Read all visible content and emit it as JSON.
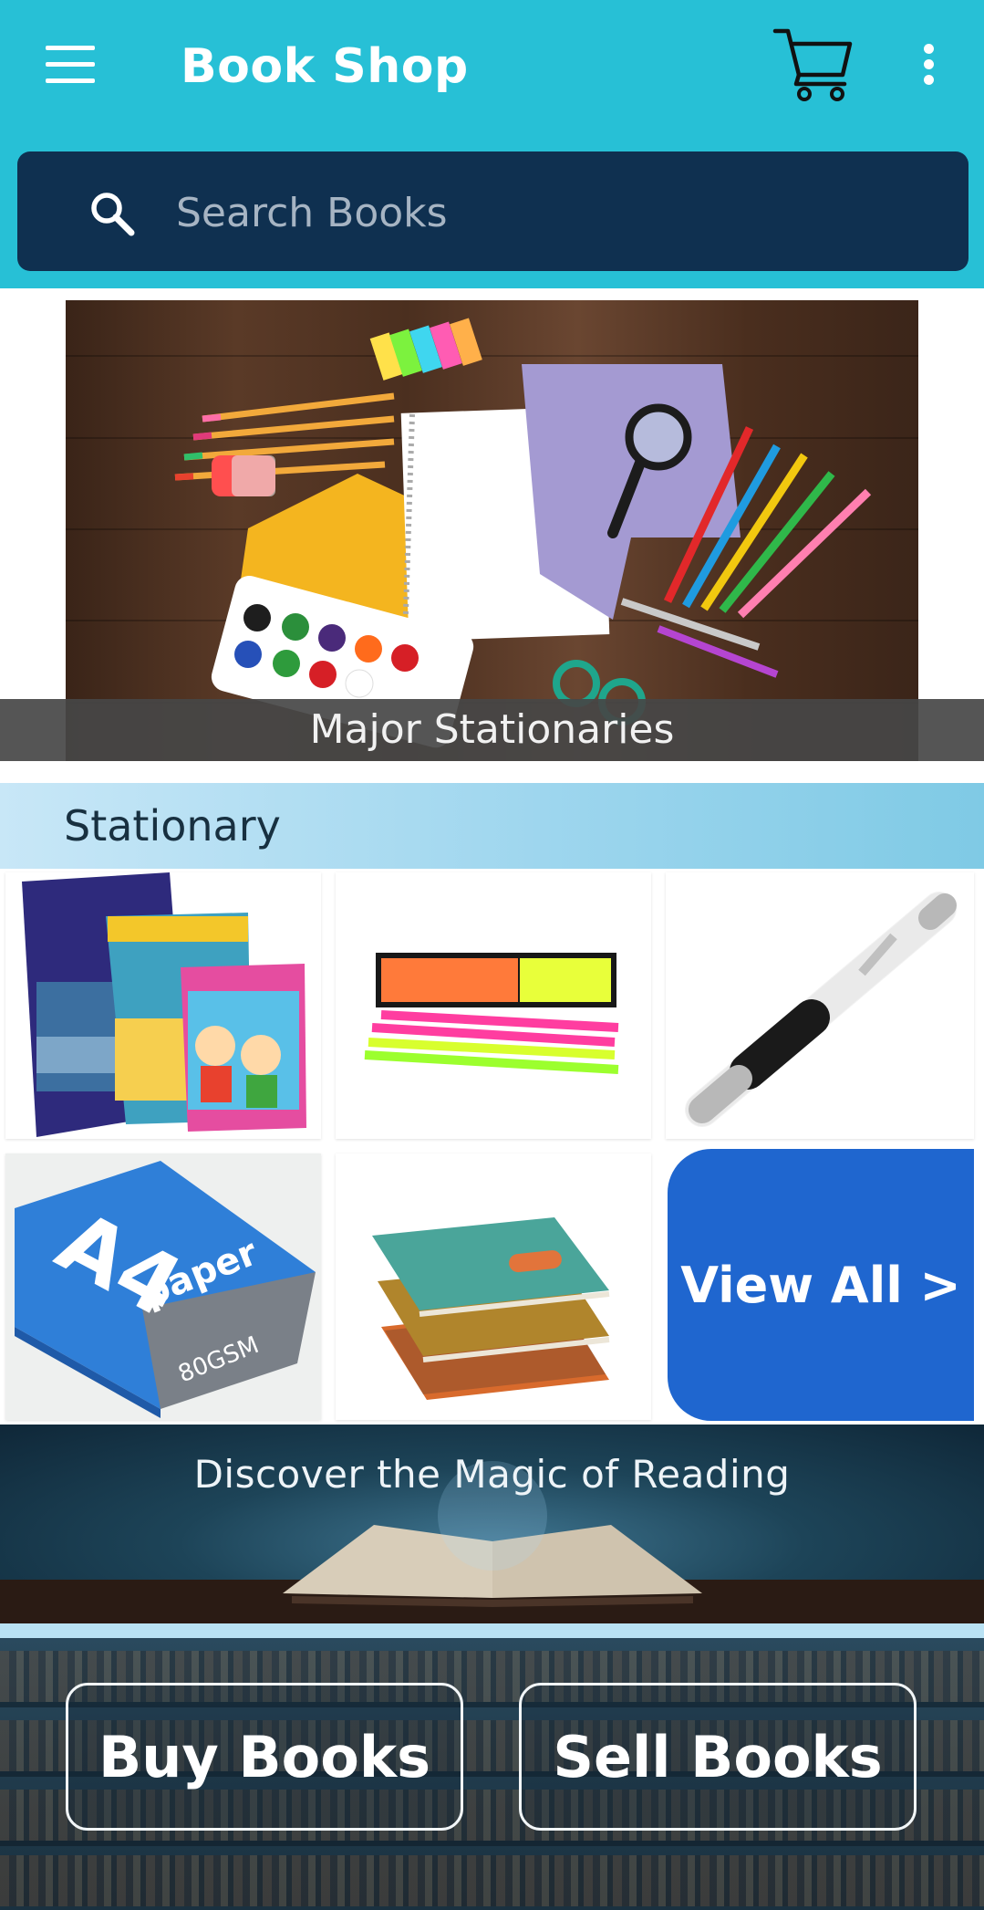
{
  "app_bar": {
    "title": "Book Shop",
    "menu_icon": "hamburger-menu-icon",
    "cart_icon": "shopping-cart-icon",
    "more_icon": "more-vertical-icon",
    "background_color": "#27c0d6"
  },
  "search": {
    "placeholder": "Search Books",
    "value": "",
    "icon": "search-icon",
    "background_color": "#0f3050"
  },
  "hero_banner": {
    "caption": "Major Stationaries"
  },
  "stationary_section": {
    "title": "Stationary",
    "products": [
      {
        "name": "classmate-notebooks",
        "image": "notebooks-image"
      },
      {
        "name": "doms-neon-pencils",
        "image": "pencils-image"
      },
      {
        "name": "ballpoint-pen",
        "image": "pen-image"
      },
      {
        "name": "a4-paper-pack",
        "image": "a4-paper-image",
        "pack_text": "A4",
        "brand_text": "paper",
        "gsm_text": "80GSM"
      },
      {
        "name": "diaries",
        "image": "diaries-image"
      }
    ],
    "view_all_label": "View All >",
    "view_all_color": "#1f66cf"
  },
  "discover_banner": {
    "text": "Discover the Magic of Reading"
  },
  "actions": {
    "buy_label": "Buy Books",
    "sell_label": "Sell Books"
  }
}
